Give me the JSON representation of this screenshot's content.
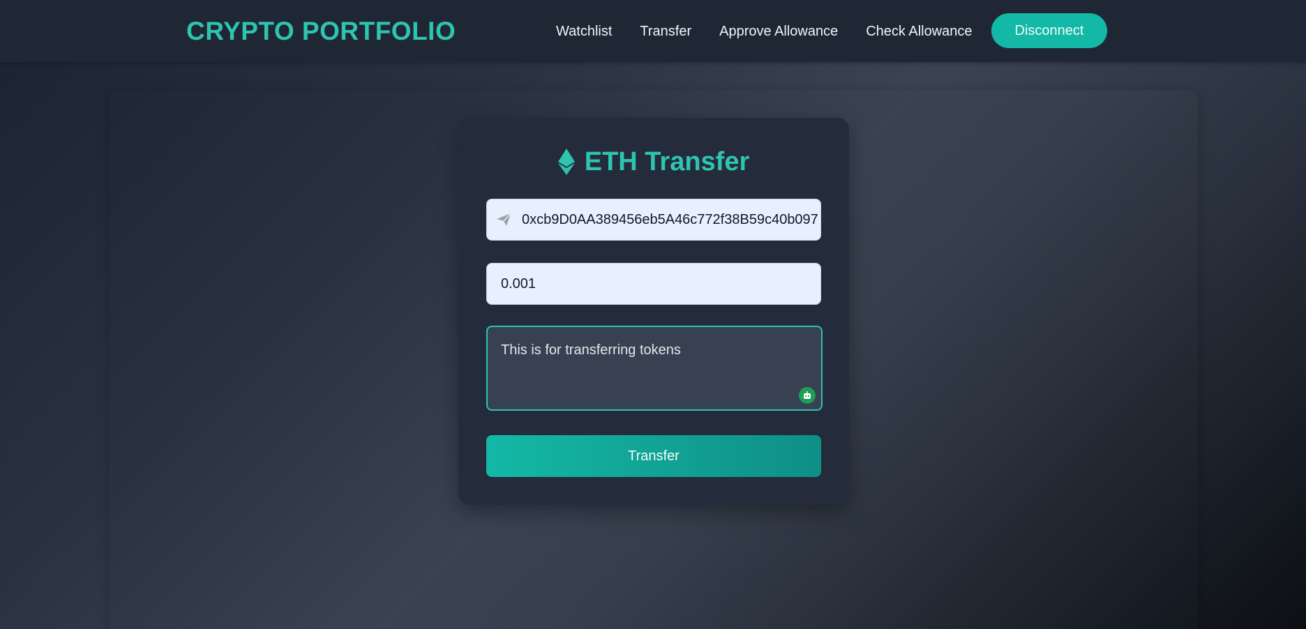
{
  "header": {
    "brand": "CRYPTO PORTFOLIO",
    "nav": [
      {
        "label": "Watchlist"
      },
      {
        "label": "Transfer"
      },
      {
        "label": "Approve Allowance"
      },
      {
        "label": "Check Allowance"
      }
    ],
    "disconnect_label": "Disconnect"
  },
  "transfer_card": {
    "title": "ETH Transfer",
    "title_icon": "ethereum-icon",
    "address_icon": "send-icon",
    "address_value": "0xcb9D0AA389456eb5A46c772f38B59c40b097",
    "amount_value": "0.001",
    "message_value": "This is for transferring tokens",
    "message_badge_icon": "bot-icon",
    "submit_label": "Transfer"
  },
  "colors": {
    "accent": "#2ec4b0",
    "button": "#14b8a6",
    "navbar": "#1f2735",
    "card": "#242c3b"
  }
}
